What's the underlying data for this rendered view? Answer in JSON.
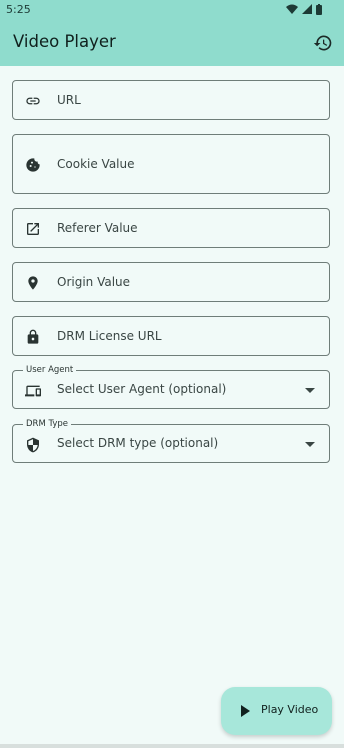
{
  "status": {
    "time": "5:25"
  },
  "appbar": {
    "title": "Video Player",
    "history_icon": "history-icon"
  },
  "fields": {
    "url": {
      "label": "URL",
      "icon": "link-icon"
    },
    "cookie": {
      "label": "Cookie Value",
      "icon": "cookie-icon"
    },
    "referer": {
      "label": "Referer Value",
      "icon": "open-in-new-icon"
    },
    "origin": {
      "label": "Origin Value",
      "icon": "location-pin-icon"
    },
    "drm_license": {
      "label": "DRM License URL",
      "icon": "lock-icon"
    },
    "user_agent": {
      "legend": "User Agent",
      "value": "Select User Agent (optional)",
      "icon": "devices-icon"
    },
    "drm_type": {
      "legend": "DRM Type",
      "value": "Select DRM type (optional)",
      "icon": "shield-icon"
    }
  },
  "fab": {
    "label": "Play Video",
    "icon": "play-icon"
  },
  "colors": {
    "appbar": "#8fdccd",
    "background": "#f1faf8",
    "fab": "#a7e7da",
    "border": "#6f7d79"
  }
}
